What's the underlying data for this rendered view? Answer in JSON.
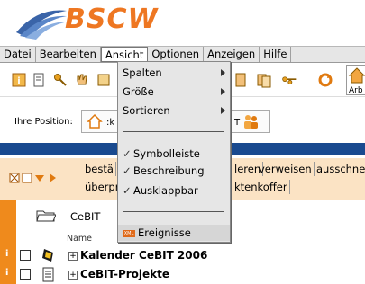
{
  "app": {
    "logo_text": "BSCW"
  },
  "menubar": {
    "items": [
      {
        "label": "Datei"
      },
      {
        "label": "Bearbeiten"
      },
      {
        "label": "Ansicht",
        "active": true
      },
      {
        "label": "Optionen"
      },
      {
        "label": "Anzeigen"
      },
      {
        "label": "Hilfe"
      }
    ]
  },
  "toolbar": {
    "arb_label": "Arb"
  },
  "position": {
    "label": "Ihre Position:",
    "path_left": ":k",
    "path_right": "IT"
  },
  "actions": {
    "row1": [
      "bestä",
      "leren",
      "verweisen",
      "ausschne"
    ],
    "row2": [
      "überpr",
      "ktenkoffer"
    ]
  },
  "folder": {
    "label": "CeBIT",
    "column_header": "Name"
  },
  "rows": [
    {
      "info": "i",
      "text": "Kalender CeBIT 2006",
      "icon": "calendar-icon"
    },
    {
      "info": "i",
      "text": "CeBIT-Projekte",
      "icon": "notepad-icon"
    }
  ],
  "dropdown": {
    "submenus": [
      {
        "label": "Spalten"
      },
      {
        "label": "Größe"
      },
      {
        "label": "Sortieren"
      }
    ],
    "checks": [
      {
        "label": "Symbolleiste",
        "checked": true
      },
      {
        "label": "Beschreibung",
        "checked": true
      },
      {
        "label": "Ausklappbar",
        "checked": true
      }
    ],
    "events": {
      "label": "Ereignisse",
      "badge": "XML"
    }
  },
  "colors": {
    "accent_orange": "#ef8a1c",
    "header_blue": "#1a4a8f",
    "action_bg": "#fbe3c4",
    "menu_bg": "#e6e6e6"
  }
}
